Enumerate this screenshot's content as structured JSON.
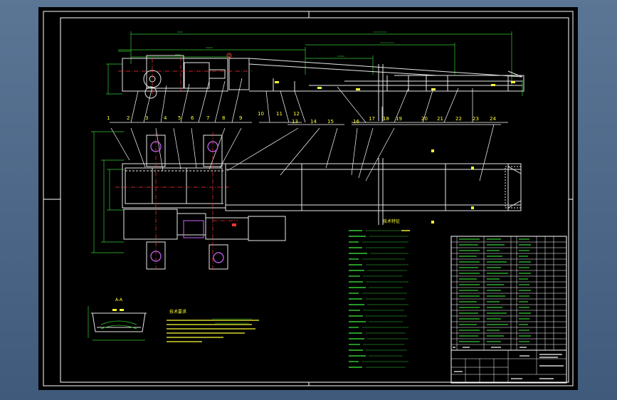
{
  "drawing": {
    "part_numbers_top": [
      "1",
      "2",
      "3",
      "4",
      "5",
      "6",
      "7",
      "8",
      "9",
      "10",
      "11",
      "12"
    ],
    "part_numbers_mid": [
      "13",
      "14",
      "15",
      "16",
      "17",
      "18",
      "19",
      "20",
      "21",
      "22",
      "23",
      "24"
    ],
    "section_label": "A-A",
    "notes_title": "技术要求",
    "spec_title": "技术特征"
  },
  "colors": {
    "background": "#000000",
    "frame": "#ffffff",
    "geometry": "#e8e8e8",
    "dimension": "#33cc33",
    "leader": "#ffffff",
    "centerline": "#ff3333",
    "part_number": "#ffff33",
    "accent": "#cc66ff",
    "table_text": "#33cc33"
  }
}
